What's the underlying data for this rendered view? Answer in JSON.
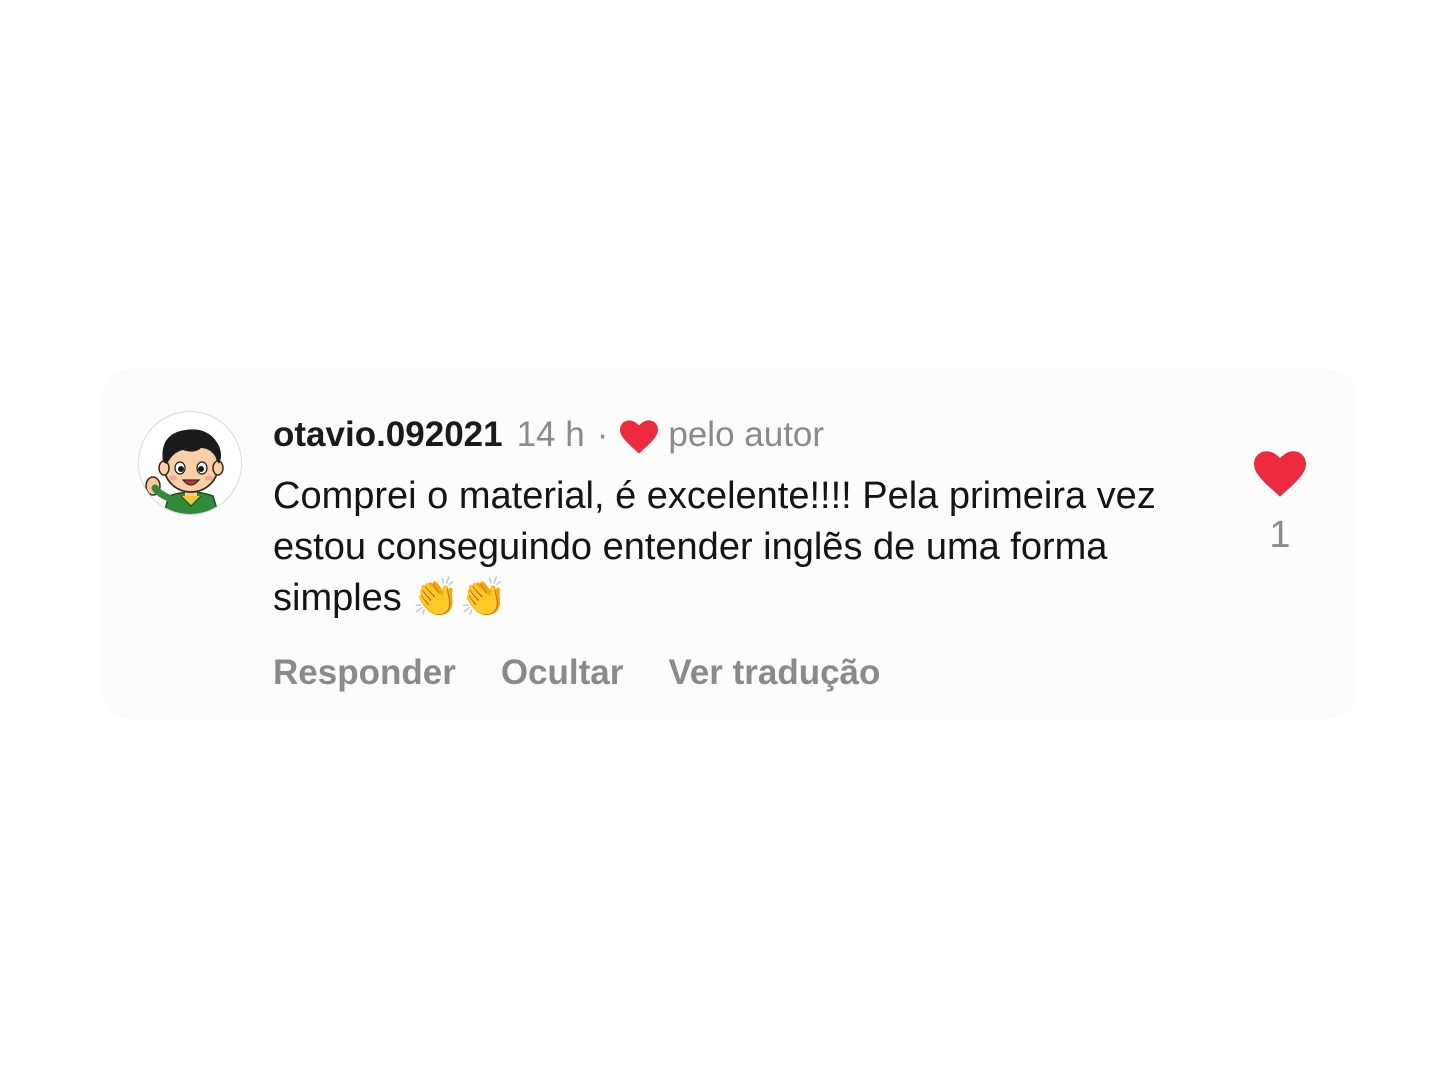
{
  "comment": {
    "username": "otavio.092021",
    "time": "14 h",
    "separator": "·",
    "author_label": "pelo autor",
    "text": "Comprei o material, é excelente!!!! Pela primeira vez estou conseguindo entender inglẽs de uma forma simples 👏👏",
    "like_count": "1",
    "avatar_icon": "cartoon-boy-avatar",
    "colors": {
      "heart": "#ed2a3e",
      "muted_text": "#8a8a8a",
      "body_text": "#141414",
      "card_background": "#fcfcfc"
    }
  },
  "actions": {
    "reply": "Responder",
    "hide": "Ocultar",
    "translate": "Ver tradução"
  }
}
